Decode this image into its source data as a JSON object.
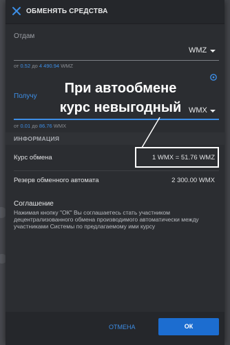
{
  "header": {
    "title": "ОБМЕНЯТЬ СРЕДСТВА"
  },
  "give": {
    "label": "Отдам",
    "currency": "WMZ",
    "range_from_word": "от",
    "range_min": "0.52",
    "range_to_word": "до",
    "range_max": "4 490.94",
    "range_unit": "WMZ"
  },
  "receive": {
    "label": "Получу",
    "currency": "WMX",
    "range_from_word": "от",
    "range_min": "0.01",
    "range_to_word": "до",
    "range_max": "86.76",
    "range_unit": "WMX"
  },
  "info": {
    "section_title": "ИНФОРМАЦИЯ",
    "rate_label": "Курс обмена",
    "rate_value": "1 WMX = 51.76 WMZ",
    "reserve_label": "Резерв обменного автомата",
    "reserve_value": "2 300.00 WMX"
  },
  "agreement": {
    "title": "Соглашение",
    "text": "Нажимая кнопку \"ОК\" Вы соглашаетесь стать участником децентрализованного обмена производимого автоматически между участниками Системы по предлагаемому ими курсу"
  },
  "footer": {
    "cancel_label": "ОТМЕНА",
    "ok_label": "ОК"
  },
  "annotation": {
    "line1": "При автообмене",
    "line2": "курс невыгодный"
  },
  "colors": {
    "accent": "#3d8ee6",
    "ok_button": "#1c6dd0",
    "background": "#2b2d31"
  },
  "icons": {
    "close": "close-icon",
    "settings": "gear-icon",
    "dropdown": "chevron-down-icon"
  }
}
